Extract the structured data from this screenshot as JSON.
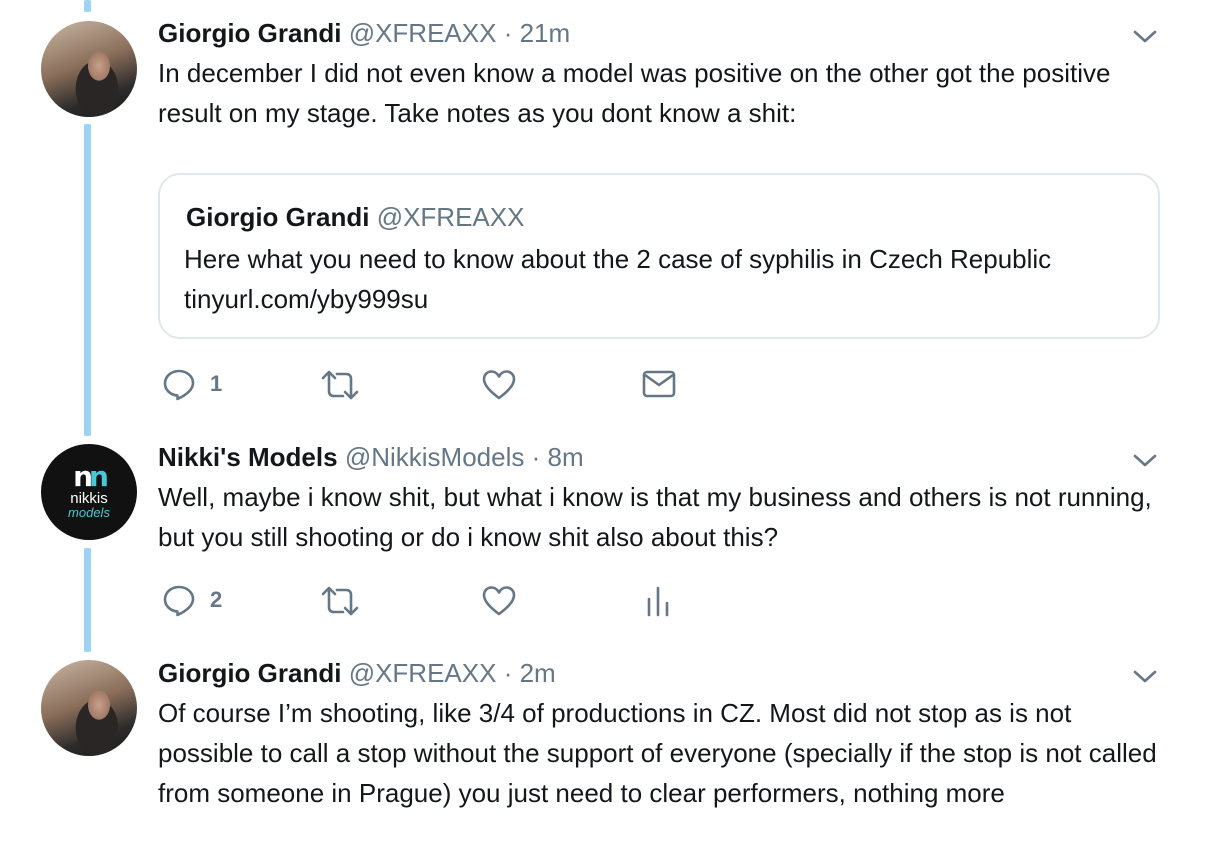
{
  "tweets": [
    {
      "name": "Giorgio Grandi",
      "handle": "@XFREAXX",
      "separator": "·",
      "time": "21m",
      "avatar_icon": "profile-photo",
      "text": "In december I did not even know a model was positive on the other got the positive result on my stage. Take notes as you dont know a shit:",
      "quote": {
        "name": "Giorgio Grandi",
        "handle": "@XFREAXX",
        "text": "Here what you need to know about the 2 case of syphilis in Czech Republic tinyurl.com/yby999su"
      },
      "actions": {
        "reply_count": "1",
        "extra_icon": "envelope-icon"
      }
    },
    {
      "name": "Nikki's Models",
      "handle": "@NikkisModels",
      "separator": "·",
      "time": "8m",
      "avatar_logo_line1": "nikkis",
      "avatar_logo_line2": "models",
      "text": "Well, maybe i know shit, but what i know is that my business and others is not running, but you still shooting or do i know shit also about this?",
      "actions": {
        "reply_count": "2",
        "extra_icon": "analytics-icon"
      }
    },
    {
      "name": "Giorgio Grandi",
      "handle": "@XFREAXX",
      "separator": "·",
      "time": "2m",
      "avatar_icon": "profile-photo",
      "text": "Of course I’m shooting, like 3/4 of productions in CZ. Most did not stop as is not possible to call a stop without the support of everyone (specially if the stop is not called from someone in Prague) you just need to clear performers, nothing more"
    }
  ],
  "colors": {
    "thread_line": "#9fd3f5",
    "secondary_text": "#657786",
    "primary_text": "#14171a",
    "border": "#e1e8ed",
    "logo_accent": "#49c7d6"
  }
}
